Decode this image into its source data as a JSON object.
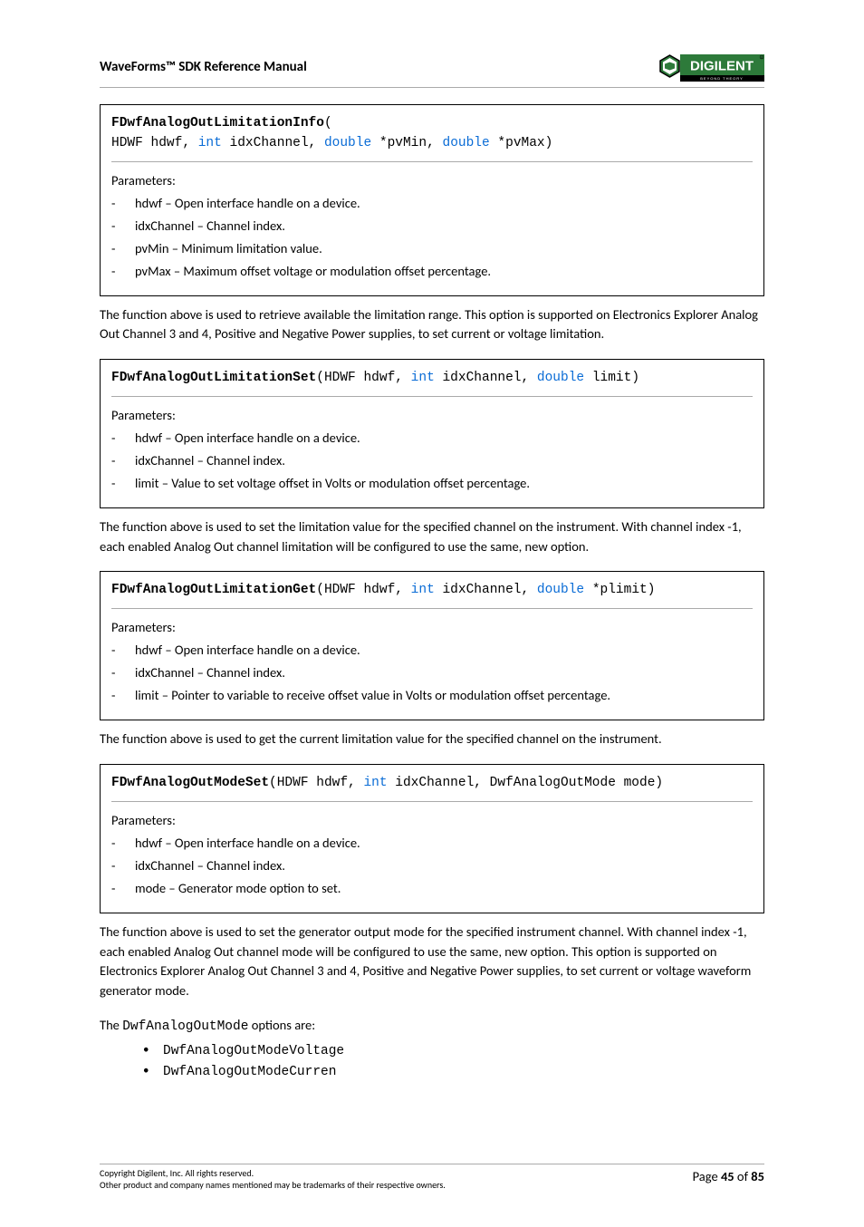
{
  "header": {
    "title": "WaveForms™ SDK Reference Manual"
  },
  "logo": {
    "brand": "DIGILENT",
    "tagline": "BEYOND THEORY"
  },
  "functions": [
    {
      "name": "FDwfAnalogOutLimitationInfo",
      "sig_tokens": [
        {
          "type": "fname",
          "text": "FDwfAnalogOutLimitationInfo"
        },
        {
          "type": "plain",
          "text": "("
        },
        {
          "type": "br"
        },
        {
          "type": "plain",
          "text": "HDWF hdwf, "
        },
        {
          "type": "kw",
          "text": "int"
        },
        {
          "type": "plain",
          "text": " idxChannel, "
        },
        {
          "type": "kw",
          "text": "double"
        },
        {
          "type": "plain",
          "text": " *pvMin, "
        },
        {
          "type": "kw",
          "text": "double"
        },
        {
          "type": "plain",
          "text": " *pvMax)"
        }
      ],
      "params_label": "Parameters:",
      "params": [
        "hdwf – Open interface handle on a device.",
        "idxChannel – Channel index.",
        "pvMin – Minimum limitation value.",
        "pvMax – Maximum offset voltage or modulation offset percentage."
      ],
      "desc": "The function above is used to retrieve available the limitation range. This option is supported on Electronics Explorer Analog Out Channel 3 and 4, Positive and Negative Power supplies, to set current or voltage limitation."
    },
    {
      "name": "FDwfAnalogOutLimitationSet",
      "sig_tokens": [
        {
          "type": "fname",
          "text": "FDwfAnalogOutLimitationSet"
        },
        {
          "type": "plain",
          "text": "(HDWF hdwf, "
        },
        {
          "type": "kw",
          "text": "int"
        },
        {
          "type": "plain",
          "text": " idxChannel, "
        },
        {
          "type": "kw",
          "text": "double"
        },
        {
          "type": "plain",
          "text": " limit)"
        }
      ],
      "params_label": "Parameters:",
      "params": [
        "hdwf – Open interface handle on a device.",
        "idxChannel – Channel index.",
        "limit – Value to set voltage offset in Volts or modulation offset percentage."
      ],
      "desc": "The function above is used to set the limitation value for the specified channel on the instrument. With channel index -1, each enabled Analog Out channel limitation will be configured to use the same, new option."
    },
    {
      "name": "FDwfAnalogOutLimitationGet",
      "sig_tokens": [
        {
          "type": "fname",
          "text": "FDwfAnalogOutLimitationGet"
        },
        {
          "type": "plain",
          "text": "(HDWF hdwf, "
        },
        {
          "type": "kw",
          "text": "int"
        },
        {
          "type": "plain",
          "text": " idxChannel, "
        },
        {
          "type": "kw",
          "text": "double"
        },
        {
          "type": "plain",
          "text": " *plimit)"
        }
      ],
      "params_label": "Parameters:",
      "params": [
        "hdwf – Open interface handle on a device.",
        "idxChannel – Channel index.",
        "limit – Pointer to variable to receive offset value in Volts or modulation offset percentage."
      ],
      "desc": "The function above is used to get the current limitation value for the specified channel on the instrument."
    },
    {
      "name": "FDwfAnalogOutModeSet",
      "sig_tokens": [
        {
          "type": "fname",
          "text": "FDwfAnalogOutModeSet"
        },
        {
          "type": "plain",
          "text": "(HDWF hdwf, "
        },
        {
          "type": "kw",
          "text": "int"
        },
        {
          "type": "plain",
          "text": " idxChannel, DwfAnalogOutMode mode)"
        }
      ],
      "params_label": "Parameters:",
      "params": [
        "hdwf – Open interface handle on a device.",
        "idxChannel – Channel index.",
        "mode – Generator mode option to set."
      ],
      "desc": "The function above is used to set the generator output mode for the specified instrument channel. With channel index -1, each enabled Analog Out channel mode will be configured to use the same, new option. This option is supported on Electronics Explorer Analog Out Channel 3 and 4, Positive and Negative Power supplies, to set current or voltage waveform generator mode."
    }
  ],
  "options": {
    "intro_prefix": "The ",
    "intro_mono": "DwfAnalogOutMode",
    "intro_suffix": " options are:",
    "items": [
      "DwfAnalogOutModeVoltage",
      "DwfAnalogOutModeCurren"
    ]
  },
  "footer": {
    "copyright": "Copyright Digilent, Inc. All rights reserved.",
    "trademark": "Other product and company names mentioned may be trademarks of their respective owners.",
    "page_prefix": "Page ",
    "page_current": "45",
    "page_of": " of ",
    "page_total": "85"
  }
}
